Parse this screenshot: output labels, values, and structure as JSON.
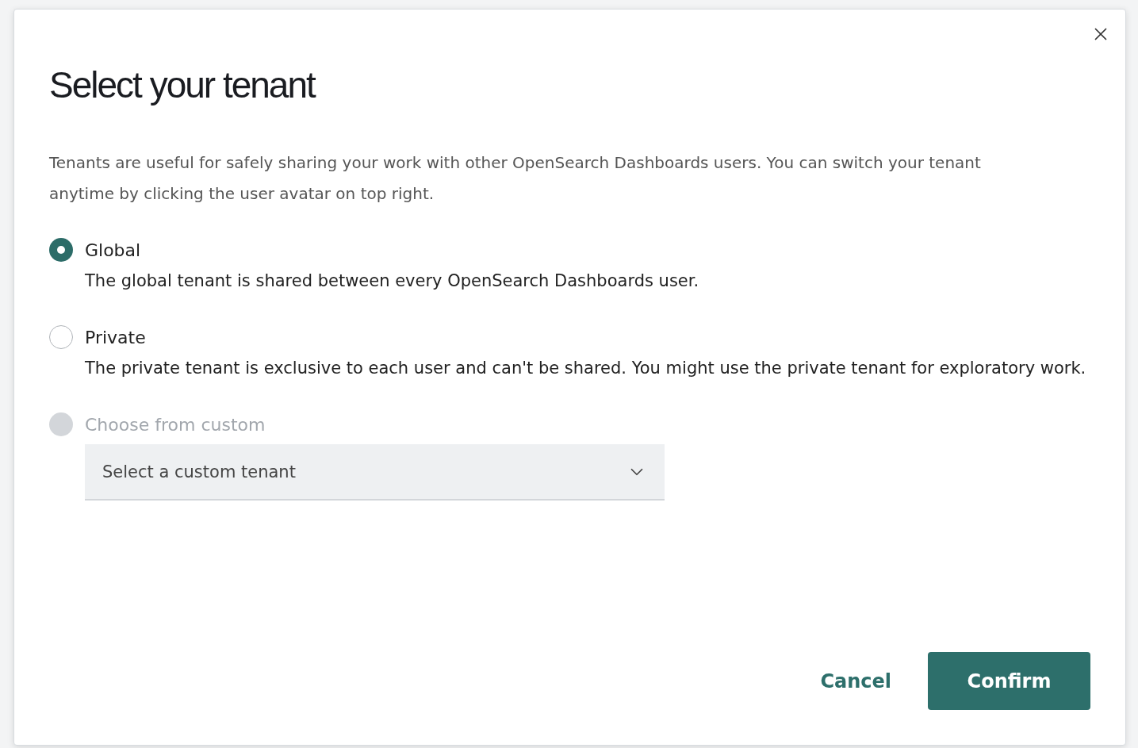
{
  "dialog": {
    "title": "Select your tenant",
    "description": "Tenants are useful for safely sharing your work with other OpenSearch Dashboards users. You can switch your tenant anytime by clicking the user avatar on top right.",
    "options": [
      {
        "label": "Global",
        "description": "The global tenant is shared between every OpenSearch Dashboards user.",
        "selected": true,
        "disabled": false
      },
      {
        "label": "Private",
        "description": "The private tenant is exclusive to each user and can't be shared. You might use the private tenant for exploratory work.",
        "selected": false,
        "disabled": false
      },
      {
        "label": "Choose from custom",
        "selected": false,
        "disabled": true
      }
    ],
    "custom_select": {
      "placeholder": "Select a custom tenant",
      "disabled": true
    },
    "buttons": [
      {
        "label": "Cancel",
        "kind": "text"
      },
      {
        "label": "Confirm",
        "kind": "primary"
      }
    ]
  }
}
